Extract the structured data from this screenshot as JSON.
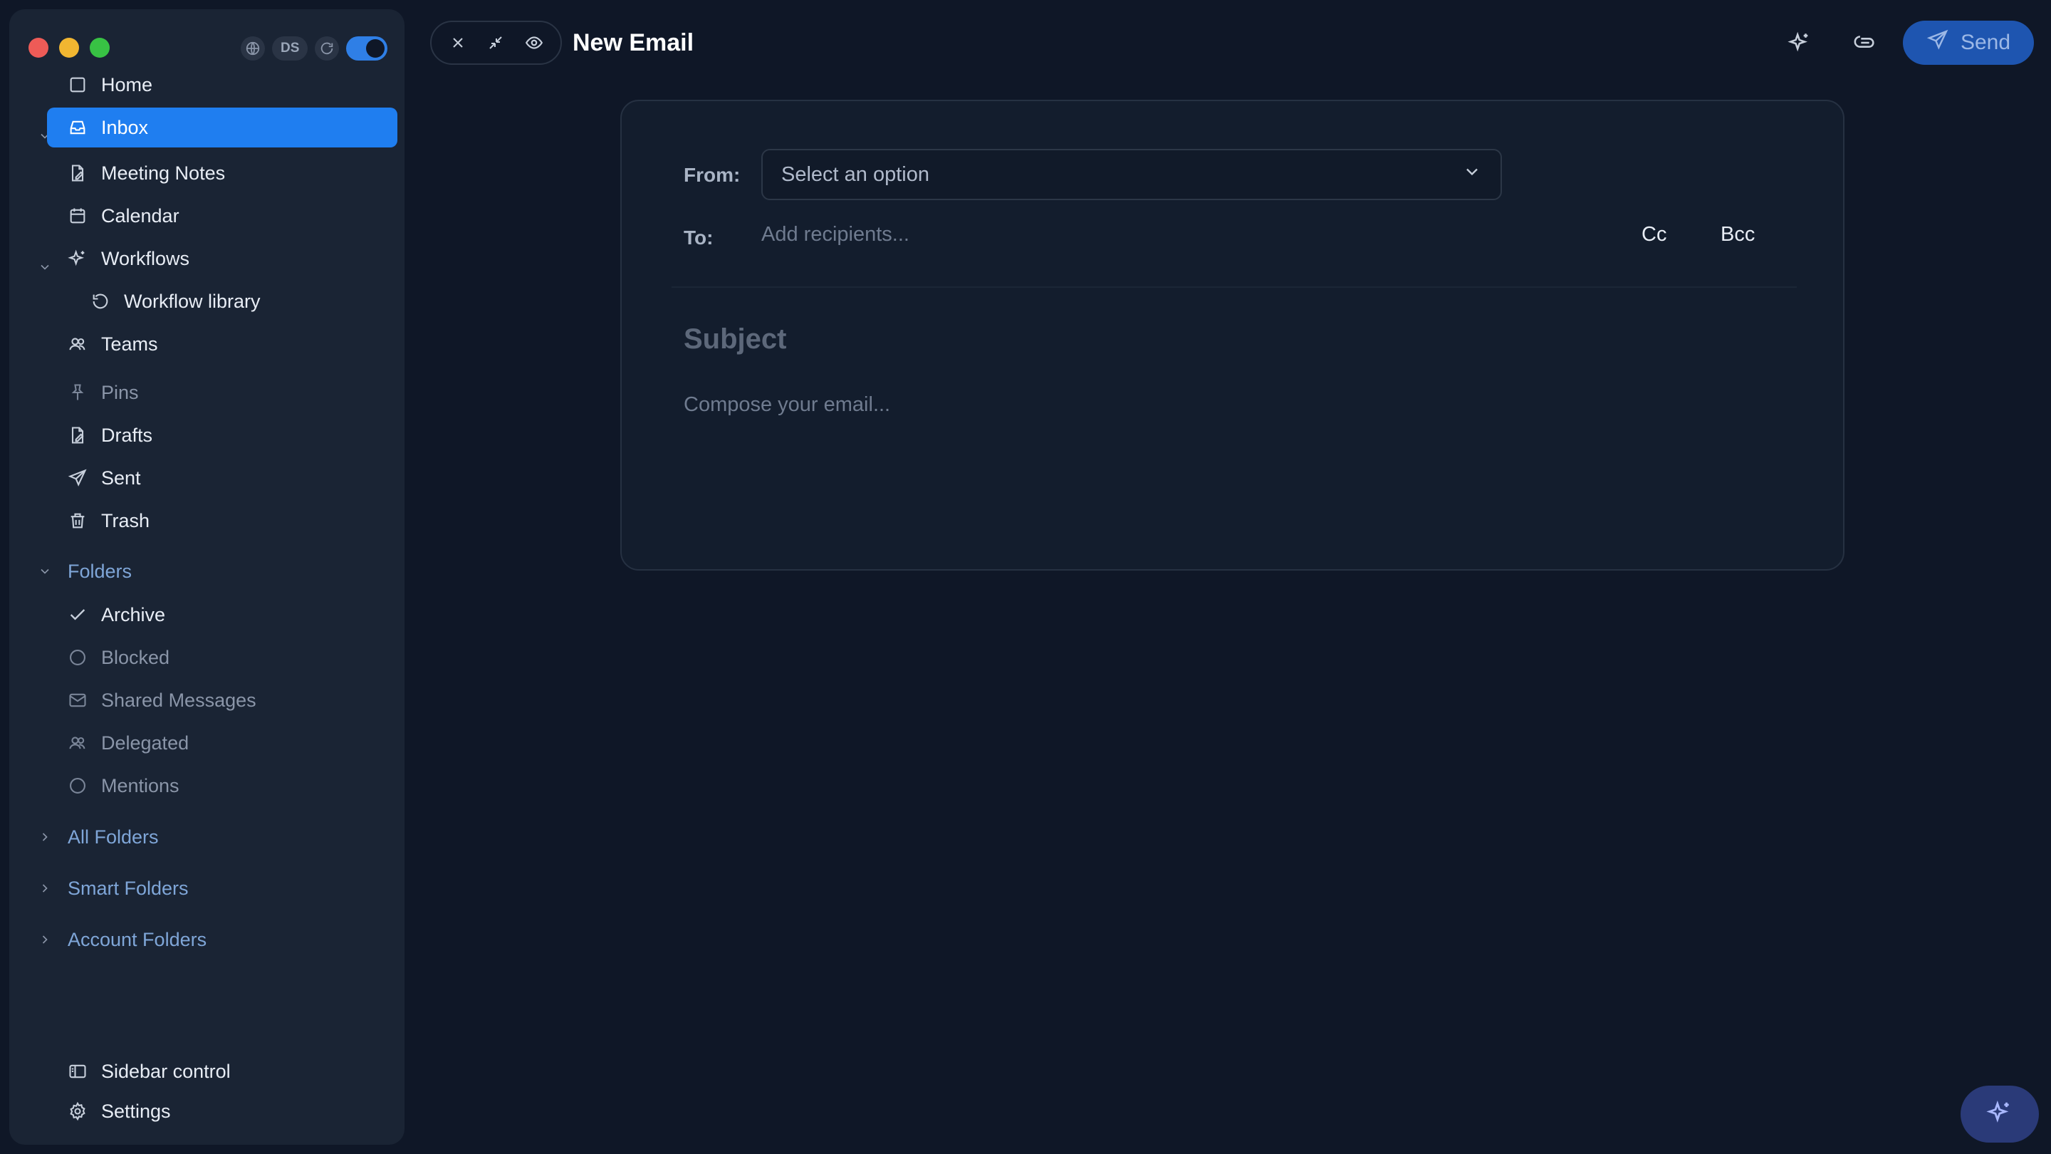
{
  "window": {
    "title": "New Email",
    "controls": [
      "close-icon",
      "minimize-icon",
      "eye-icon"
    ]
  },
  "top_controls": {
    "globe": "globe-icon",
    "user_badge": "DS",
    "refresh": "refresh-icon",
    "toggle_on": true
  },
  "sidebar": {
    "items": [
      {
        "label": "Home",
        "icon": "home-icon"
      },
      {
        "label": "Inbox",
        "icon": "inbox-icon",
        "active": true
      },
      {
        "label": "Meeting Notes",
        "icon": "note-icon"
      },
      {
        "label": "Calendar",
        "icon": "calendar-icon"
      },
      {
        "label": "Workflows",
        "icon": "sparkle-icon"
      },
      {
        "label": "Workflow library",
        "icon": "history-icon"
      },
      {
        "label": "Teams",
        "icon": "users-icon"
      },
      {
        "label": "Pins",
        "icon": "pin-icon"
      },
      {
        "label": "Drafts",
        "icon": "draft-icon"
      },
      {
        "label": "Sent",
        "icon": "send-icon"
      },
      {
        "label": "Trash",
        "icon": "trash-icon"
      }
    ],
    "folders": {
      "title": "Folders",
      "items": [
        {
          "label": "Archive",
          "icon": "check-icon"
        },
        {
          "label": "Blocked",
          "icon": "circle-icon"
        },
        {
          "label": "Shared Messages",
          "icon": "mail-icon"
        },
        {
          "label": "Delegated",
          "icon": "users-icon"
        },
        {
          "label": "Mentions",
          "icon": "circle-icon"
        }
      ]
    },
    "sections": [
      "All Folders",
      "Smart Folders",
      "Account Folders"
    ],
    "footer": [
      {
        "label": "Sidebar control",
        "icon": "sidebar-icon"
      },
      {
        "label": "Settings",
        "icon": "gear-icon"
      }
    ]
  },
  "header": {
    "send_label": "Send"
  },
  "compose": {
    "from_label": "From:",
    "from_value": "Select an option",
    "to_label": "To:",
    "to_placeholder": "Add recipients...",
    "cc_label": "Cc",
    "bcc_label": "Bcc",
    "subject_placeholder": "Subject",
    "body_placeholder": "Compose your email..."
  },
  "colors": {
    "accent": "#1f7ef0",
    "background": "#0f1727",
    "sidebar": "#1a2434"
  }
}
